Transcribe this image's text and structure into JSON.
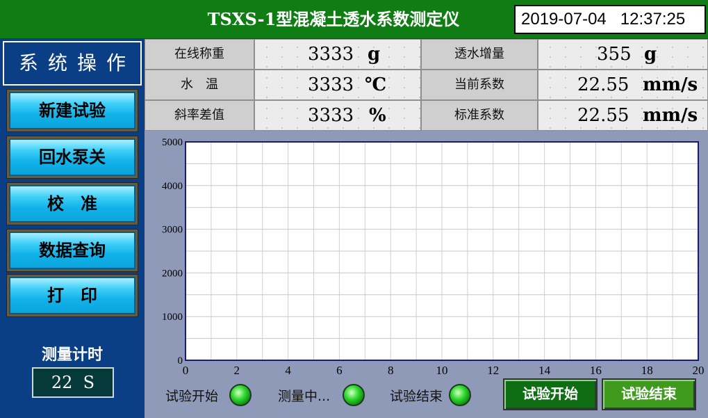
{
  "header": {
    "title": "TSXS-1型混凝土透水系数测定仪",
    "date": "2019-07-04",
    "time": "12:37:25"
  },
  "sidebar": {
    "title": "系统操作",
    "buttons": [
      {
        "label": "新建试验"
      },
      {
        "label": "回水泵关"
      },
      {
        "label": "校　准"
      },
      {
        "label": "数据查询"
      },
      {
        "label": "打　印"
      }
    ],
    "timer_label": "测量计时",
    "timer_value": "22",
    "timer_unit": "S"
  },
  "measurements": [
    {
      "label": "在线称重",
      "value": "3333",
      "unit": "g"
    },
    {
      "label": "透水增量",
      "value": "355",
      "unit": "g"
    },
    {
      "label": "水　温",
      "value": "3333",
      "unit": "℃"
    },
    {
      "label": "当前系数",
      "value": "22.55",
      "unit": "mm/s"
    },
    {
      "label": "斜率差值",
      "value": "3333",
      "unit": "%"
    },
    {
      "label": "标准系数",
      "value": "22.55",
      "unit": "mm/s"
    }
  ],
  "chart_data": {
    "type": "line",
    "title": "",
    "xlabel": "",
    "ylabel": "",
    "xlim": [
      0,
      20
    ],
    "ylim": [
      0,
      5000
    ],
    "x_ticks": [
      "0",
      "2",
      "4",
      "6",
      "8",
      "10",
      "12",
      "14",
      "16",
      "18",
      "20"
    ],
    "y_ticks": [
      "0",
      "1000",
      "2000",
      "3000",
      "4000",
      "5000"
    ],
    "grid": true,
    "series": []
  },
  "indicators": [
    {
      "label": "试验开始",
      "color": "#2fd82f"
    },
    {
      "label": "测量中...",
      "color": "#2fd82f"
    },
    {
      "label": "试验结束",
      "color": "#2fd82f"
    }
  ],
  "actions": {
    "start_label": "试验开始",
    "start_color": "#0f6e13",
    "end_label": "试验结束",
    "end_color": "#3f9a1e"
  }
}
